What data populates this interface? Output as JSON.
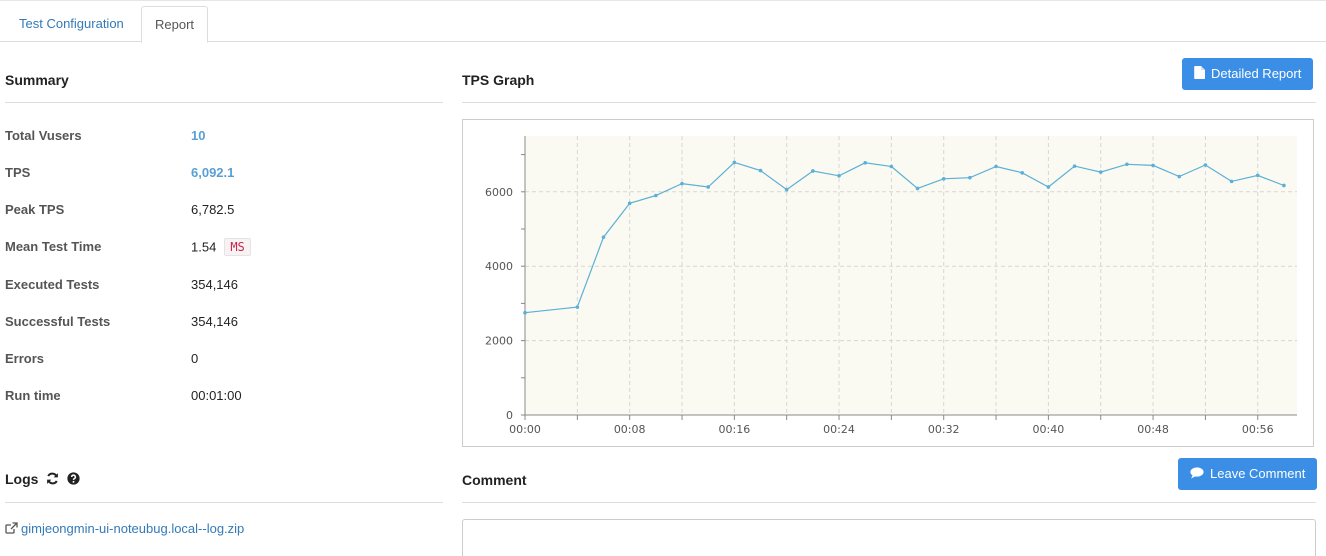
{
  "tabs": [
    {
      "label": "Test Configuration",
      "active": false
    },
    {
      "label": "Report",
      "active": true
    }
  ],
  "summary": {
    "title": "Summary",
    "rows": [
      {
        "label": "Total Vusers",
        "value": "10"
      },
      {
        "label": "TPS",
        "value": "6,092.1"
      },
      {
        "label": "Peak TPS",
        "value": "6,782.5"
      },
      {
        "label": "Mean Test Time",
        "value": "1.54",
        "unit": "MS"
      },
      {
        "label": "Executed Tests",
        "value": "354,146"
      },
      {
        "label": "Successful Tests",
        "value": "354,146"
      },
      {
        "label": "Errors",
        "value": "0"
      },
      {
        "label": "Run time",
        "value": "00:01:00"
      }
    ]
  },
  "tps_graph": {
    "title": "TPS Graph",
    "detailed_report_label": "Detailed Report"
  },
  "logs": {
    "title": "Logs",
    "file_link": "gimjeongmin-ui-noteubug.local--log.zip"
  },
  "comment": {
    "title": "Comment",
    "leave_comment_label": "Leave Comment"
  },
  "colors": {
    "accent": "#3a8ee6",
    "link": "#337ab7",
    "value_link": "#5a9fd4",
    "series": "#5ab0d6",
    "plot_bg": "#fbfaf2"
  },
  "chart_data": {
    "type": "line",
    "title": "",
    "xlabel": "",
    "ylabel": "",
    "ylim": [
      0,
      7500
    ],
    "x_tick_labels": [
      "00:00",
      "00:08",
      "00:16",
      "00:24",
      "00:32",
      "00:40",
      "00:48",
      "00:56"
    ],
    "y_tick_labels": [
      "0",
      "2000",
      "4000",
      "6000"
    ],
    "grid": true,
    "series": [
      {
        "name": "",
        "x": [
          "00:00",
          "00:04",
          "00:06",
          "00:08",
          "00:10",
          "00:12",
          "00:14",
          "00:16",
          "00:18",
          "00:20",
          "00:22",
          "00:24",
          "00:26",
          "00:28",
          "00:30",
          "00:32",
          "00:34",
          "00:36",
          "00:38",
          "00:40",
          "00:42",
          "00:44",
          "00:46",
          "00:48",
          "00:50",
          "00:52",
          "00:54",
          "00:56",
          "00:58"
        ],
        "values": [
          2750,
          2900,
          4780,
          5690,
          5900,
          6220,
          6130,
          6790,
          6570,
          6060,
          6560,
          6430,
          6780,
          6680,
          6090,
          6350,
          6380,
          6680,
          6510,
          6130,
          6690,
          6530,
          6740,
          6710,
          6410,
          6720,
          6280,
          6440,
          6170
        ]
      }
    ]
  }
}
